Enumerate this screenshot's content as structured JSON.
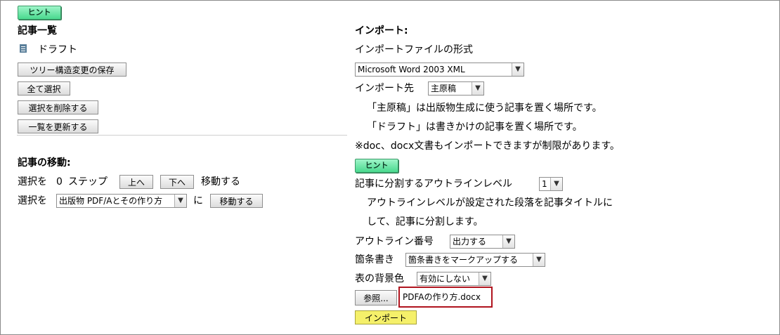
{
  "hint_label": "ヒント",
  "left": {
    "article_list_title": "記事一覧",
    "draft_label": "ドラフト",
    "save_tree_button": "ツリー構造変更の保存",
    "select_all_button": "全て選択",
    "delete_selected_button": "選択を削除する",
    "refresh_list_button": "一覧を更新する",
    "move_title": "記事の移動:",
    "move_row": {
      "prefix": "選択を",
      "steps": "0",
      "step_label": "ステップ",
      "up_button": "上へ",
      "down_button": "下へ",
      "suffix": "移動する"
    },
    "move_to_row": {
      "prefix": "選択を",
      "target_value": "出版物 PDF/Aとその作り方",
      "particle": "に",
      "move_button": "移動する"
    }
  },
  "right": {
    "import_title": "インポート:",
    "format_label": "インポートファイルの形式",
    "format_value": "Microsoft Word 2003 XML",
    "destination_label": "インポート先",
    "destination_value": "主原稿",
    "note_main": "「主原稿」は出版物生成に使う記事を置く場所です。",
    "note_draft": "「ドラフト」は書きかけの記事を置く場所です。",
    "note_docx": "※doc、docx文書もインポートできますが制限があります。",
    "outline_level_label": "記事に分割するアウトラインレベル",
    "outline_level_value": "1",
    "outline_note_1": "アウトラインレベルが設定された段落を記事タイトルに",
    "outline_note_2": "して、記事に分割します。",
    "outline_number_label": "アウトライン番号",
    "outline_number_value": "出力する",
    "bullets_label": "箇条書き",
    "bullets_value": "箇条書きをマークアップする",
    "table_bg_label": "表の背景色",
    "table_bg_value": "有効にしない",
    "browse_button": "参照...",
    "file_name": "PDFAの作り方.docx",
    "import_button": "インポート"
  },
  "colors": {
    "hint_green": "#49d98e",
    "import_yellow": "#f5f06a",
    "highlight_red": "#b0141e"
  }
}
